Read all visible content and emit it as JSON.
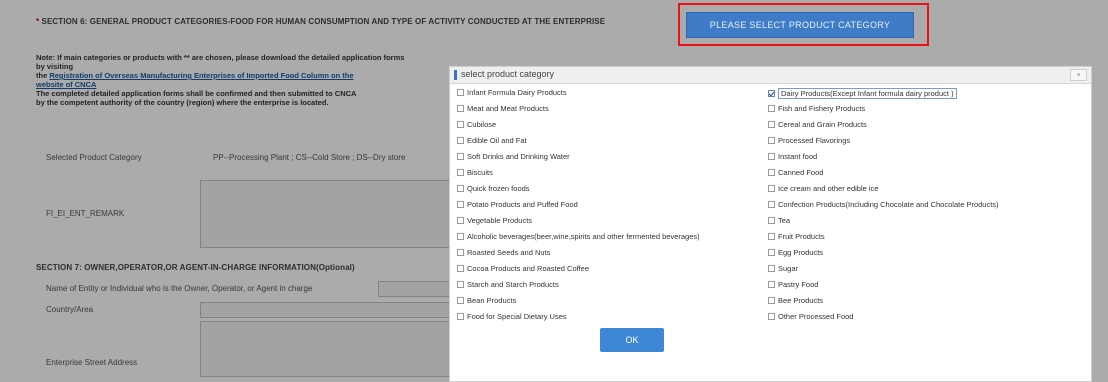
{
  "page": {
    "section6_title": "SECTION 6: GENERAL PRODUCT CATEGORIES-FOOD FOR HUMAN CONSUMPTION AND TYPE OF ACTIVITY CONDUCTED AT THE ENTERPRISE",
    "note_line1": "Note: If main categories or products with ** are chosen, please download the detailed application forms",
    "note_line2": "by visiting",
    "note_link_text": "Registration of Overseas Manufacturing Enterprises of Imported Food Column on the",
    "note_link_text2": "website of CNCA",
    "note_line4": "The completed detailed application forms shall be confirmed and then submitted to CNCA",
    "note_line5": "by the competent authority of the country (region) where the enterprise is located.",
    "selected_category_label": "Selected Product Category",
    "plant_legend": "PP--Processing Plant ; CS--Cold Store ; DS--Dry store",
    "remark_label": "FI_EI_ENT_REMARK",
    "section7_title": "SECTION 7: OWNER,OPERATOR,OR AGENT-IN-CHARGE INFORMATION(Optional)",
    "owner_name_label": "Name of Entity or Individual who is the Owner, Operator, or Agent in charge",
    "country_label": "Country/Area",
    "street_label": "Enterprise Street Address"
  },
  "category_button_label": "PLEASE SELECT PRODUCT CATEGORY",
  "dialog": {
    "title": "select product category",
    "close_label": "×",
    "ok_label": "OK",
    "left_items": [
      {
        "label": "Infant Formula Dairy Products",
        "checked": false
      },
      {
        "label": "Meat and Meat Products",
        "checked": false
      },
      {
        "label": "Cubilose",
        "checked": false
      },
      {
        "label": "Edible Oil and Fat",
        "checked": false
      },
      {
        "label": "Soft Drinks and Drinking Water",
        "checked": false
      },
      {
        "label": "Biscuits",
        "checked": false
      },
      {
        "label": "Quick frozen foods",
        "checked": false
      },
      {
        "label": "Potato Products and Puffed Food",
        "checked": false
      },
      {
        "label": "Vegetable Products",
        "checked": false
      },
      {
        "label": "Alcoholic beverages(beer,wine,spirits and other fermented beverages)",
        "checked": false
      },
      {
        "label": "Roasted Seeds and Nuts",
        "checked": false
      },
      {
        "label": "Cocoa Products and Roasted Coffee",
        "checked": false
      },
      {
        "label": "Starch and Starch Products",
        "checked": false
      },
      {
        "label": "Bean Products",
        "checked": false
      },
      {
        "label": "Food for Special Dietary Uses",
        "checked": false
      }
    ],
    "right_items": [
      {
        "label": "Dairy Products(Except Infant formula dairy product )",
        "checked": true
      },
      {
        "label": "Fish and Fishery Products",
        "checked": false
      },
      {
        "label": "Cereal and Grain Products",
        "checked": false
      },
      {
        "label": "Processed Flavorings",
        "checked": false
      },
      {
        "label": "Instant food",
        "checked": false
      },
      {
        "label": "Canned Food",
        "checked": false
      },
      {
        "label": "Ice cream and other edible ice",
        "checked": false
      },
      {
        "label": "Confection Products(Including Chocolate and Chocolate Products)",
        "checked": false
      },
      {
        "label": "Tea",
        "checked": false
      },
      {
        "label": "Fruit Products",
        "checked": false
      },
      {
        "label": "Egg Products",
        "checked": false
      },
      {
        "label": "Sugar",
        "checked": false
      },
      {
        "label": "Pastry Food",
        "checked": false
      },
      {
        "label": "Bee Products",
        "checked": false
      },
      {
        "label": "Other Processed Food",
        "checked": false
      }
    ]
  }
}
